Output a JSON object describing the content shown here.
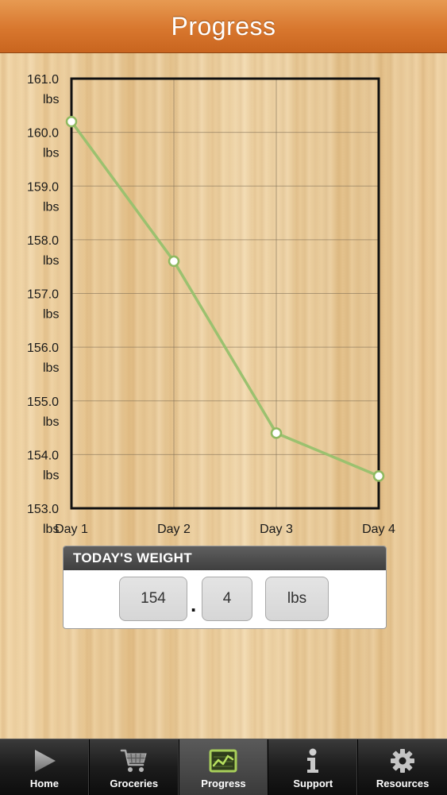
{
  "header": {
    "title": "Progress"
  },
  "chart_data": {
    "type": "line",
    "categories": [
      "Day 1",
      "Day 2",
      "Day 3",
      "Day 4"
    ],
    "values": [
      160.2,
      157.6,
      154.4,
      153.6
    ],
    "y_ticks": [
      {
        "value": 161.0,
        "line1": "161.0",
        "line2": "lbs"
      },
      {
        "value": 160.0,
        "line1": "160.0",
        "line2": "lbs"
      },
      {
        "value": 159.0,
        "line1": "159.0",
        "line2": "lbs"
      },
      {
        "value": 158.0,
        "line1": "158.0",
        "line2": "lbs"
      },
      {
        "value": 157.0,
        "line1": "157.0",
        "line2": "lbs"
      },
      {
        "value": 156.0,
        "line1": "156.0",
        "line2": "lbs"
      },
      {
        "value": 155.0,
        "line1": "155.0",
        "line2": "lbs"
      },
      {
        "value": 154.0,
        "line1": "154.0",
        "line2": "lbs"
      },
      {
        "value": 153.0,
        "line1": "153.0",
        "line2": "lbs"
      }
    ],
    "ylim": [
      153,
      161
    ],
    "title": "",
    "xlabel": "",
    "ylabel": "",
    "grid": true,
    "line_color": "#9bc16f",
    "marker_stroke": "#8fb960",
    "marker_fill": "#ffffff"
  },
  "todays_weight": {
    "title": "TODAY'S WEIGHT",
    "whole": "154",
    "separator": ".",
    "fraction": "4",
    "unit": "lbs"
  },
  "tabbar": {
    "tabs": [
      {
        "label": "Home",
        "icon": "play-icon",
        "active": false
      },
      {
        "label": "Groceries",
        "icon": "cart-icon",
        "active": false
      },
      {
        "label": "Progress",
        "icon": "chart-icon",
        "active": true
      },
      {
        "label": "Support",
        "icon": "info-icon",
        "active": false
      },
      {
        "label": "Resources",
        "icon": "gear-icon",
        "active": false
      }
    ]
  }
}
